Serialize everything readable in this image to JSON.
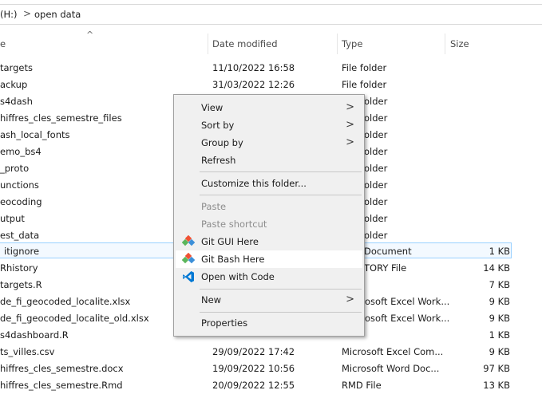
{
  "address": {
    "drive": "(H:)",
    "separator": ">",
    "folder": "open data"
  },
  "columns": {
    "sort_arrow": "^",
    "name": "e",
    "date": "Date modified",
    "type": "Type",
    "size": "Size"
  },
  "files": [
    {
      "name": "targets",
      "date": "11/10/2022 16:58",
      "type": "File folder",
      "size": ""
    },
    {
      "name": "ackup",
      "date": "31/03/2022 12:26",
      "type": "File folder",
      "size": ""
    },
    {
      "name": "s4dash",
      "date": "",
      "type": "older",
      "size": ""
    },
    {
      "name": "hiffres_cles_semestre_files",
      "date": "",
      "type": "older",
      "size": ""
    },
    {
      "name": "ash_local_fonts",
      "date": "",
      "type": "older",
      "size": ""
    },
    {
      "name": "emo_bs4",
      "date": "",
      "type": "older",
      "size": ""
    },
    {
      "name": "_proto",
      "date": "",
      "type": "older",
      "size": ""
    },
    {
      "name": "unctions",
      "date": "",
      "type": "older",
      "size": ""
    },
    {
      "name": "eocoding",
      "date": "",
      "type": "older",
      "size": ""
    },
    {
      "name": "utput",
      "date": "",
      "type": "older",
      "size": ""
    },
    {
      "name": "est_data",
      "date": "",
      "type": "older",
      "size": ""
    },
    {
      "name": "itignore",
      "date": "",
      "type": "Document",
      "size": "1 KB"
    },
    {
      "name": "Rhistory",
      "date": "",
      "type": "TORY File",
      "size": "14 KB"
    },
    {
      "name": "targets.R",
      "date": "",
      "type": "",
      "size": "7 KB"
    },
    {
      "name": "de_fi_geocoded_localite.xlsx",
      "date": "",
      "type": "osoft Excel Work...",
      "size": "9 KB"
    },
    {
      "name": "de_fi_geocoded_localite_old.xlsx",
      "date": "",
      "type": "osoft Excel Work...",
      "size": "9 KB"
    },
    {
      "name": "s4dashboard.R",
      "date": "",
      "type": "",
      "size": "1 KB"
    },
    {
      "name": "ts_villes.csv",
      "date": "29/09/2022 17:42",
      "type": "Microsoft Excel Com...",
      "size": "9 KB"
    },
    {
      "name": "hiffres_cles_semestre.docx",
      "date": "19/09/2022 10:56",
      "type": "Microsoft Word Doc...",
      "size": "97 KB"
    },
    {
      "name": "hiffres_cles_semestre.Rmd",
      "date": "20/09/2022 12:55",
      "type": "RMD File",
      "size": "13 KB"
    }
  ],
  "menu": {
    "view": "View",
    "sort_by": "Sort by",
    "group_by": "Group by",
    "refresh": "Refresh",
    "customize": "Customize this folder...",
    "paste": "Paste",
    "paste_shortcut": "Paste shortcut",
    "git_gui": "Git GUI Here",
    "git_bash": "Git Bash Here",
    "open_code": "Open with Code",
    "new": "New",
    "properties": "Properties",
    "submenu_arrow": ">"
  },
  "colors": {
    "selection_border": "#99d1ff",
    "menu_bg": "#f0f0f0",
    "git_orange": "#f05133",
    "git_green": "#5bb65b",
    "git_blue": "#3c8fd8",
    "vscode_blue": "#0078d4"
  },
  "icons": {
    "git_gui": "git-gui-icon",
    "git_bash": "git-bash-icon",
    "vscode": "vscode-icon"
  }
}
